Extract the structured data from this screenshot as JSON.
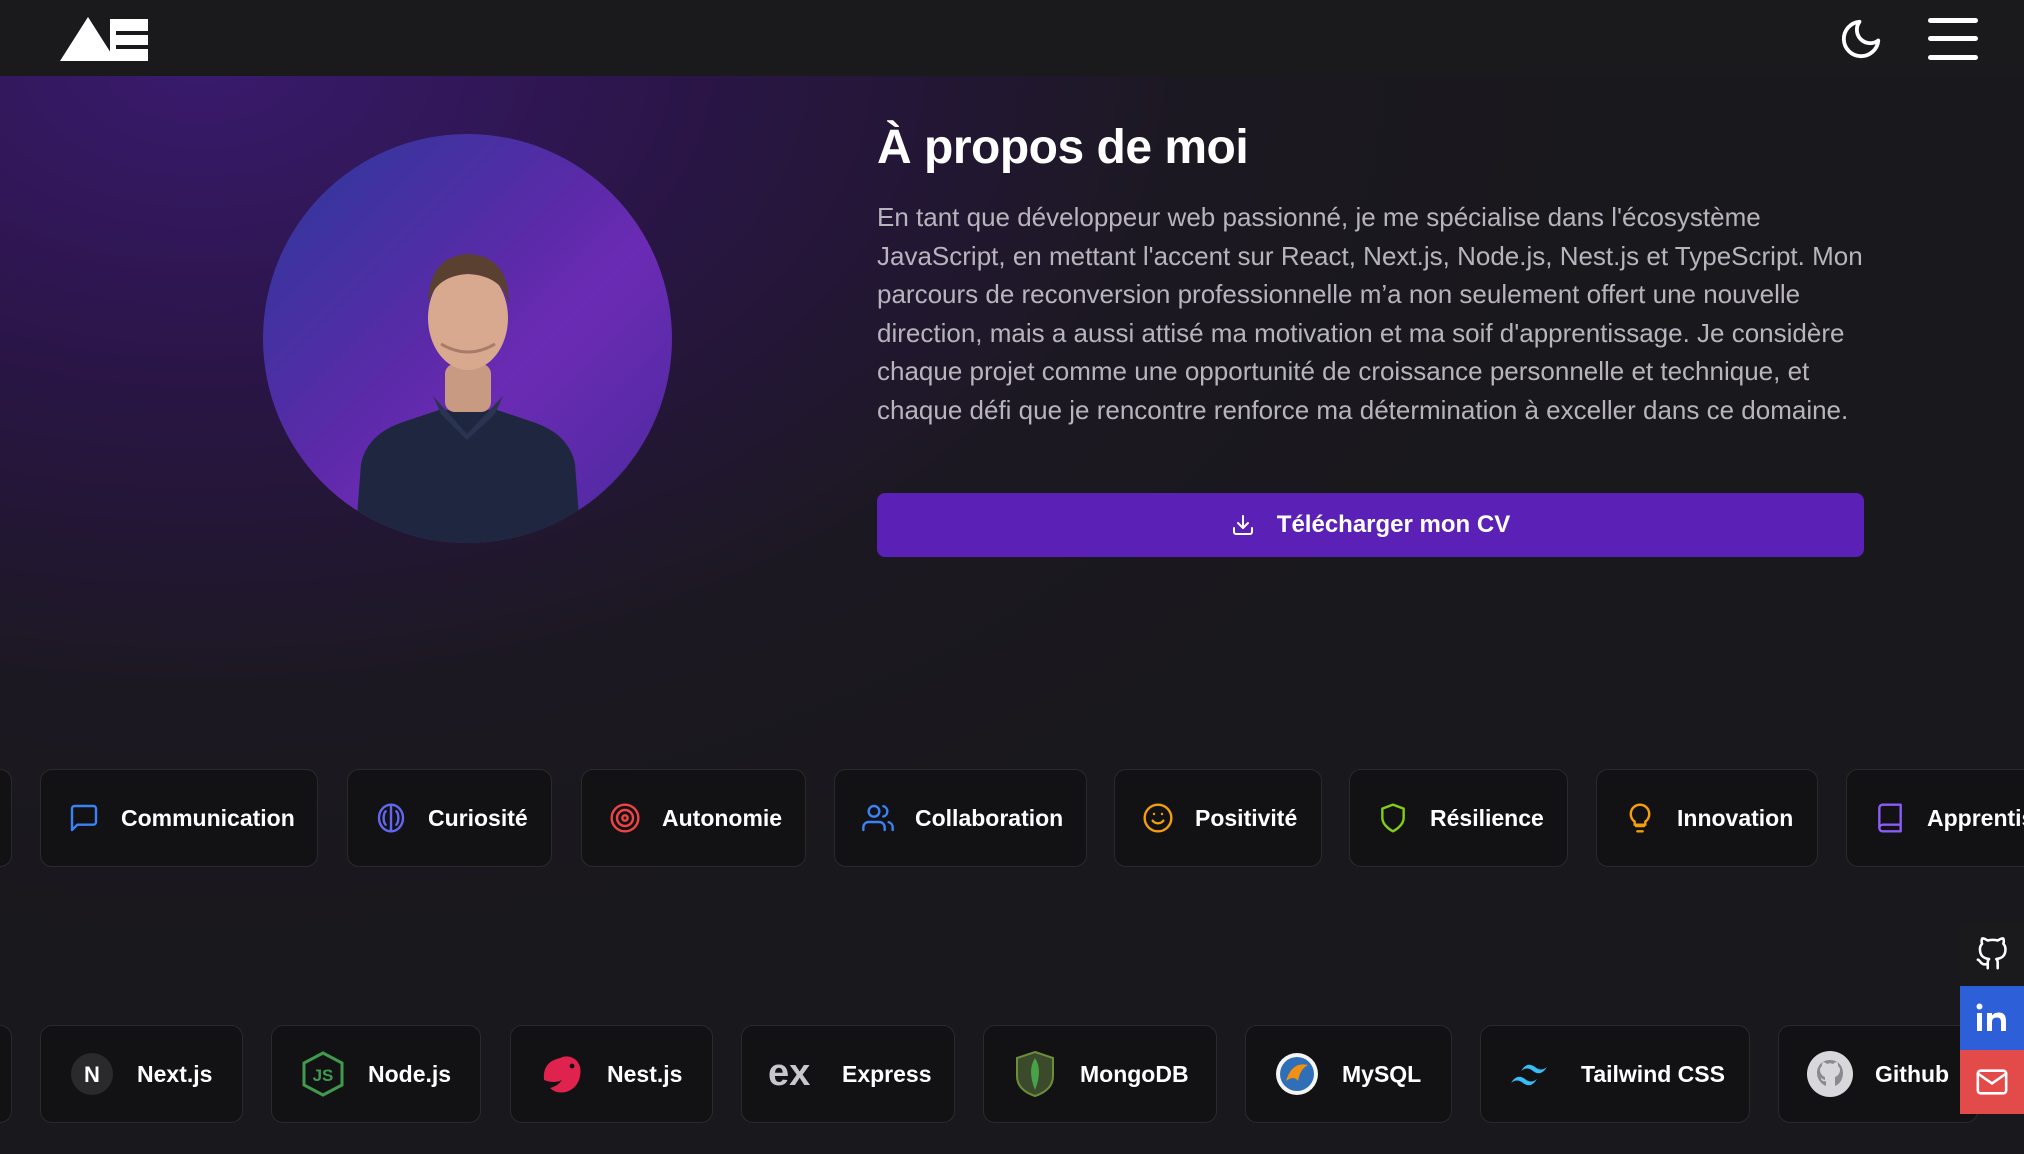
{
  "header": {
    "logo_icon": "ae-logo-icon",
    "theme_toggle_icon": "moon-icon",
    "menu_icon": "hamburger-menu-icon"
  },
  "about": {
    "title": "À propos de moi",
    "paragraph": "En tant que développeur web passionné, je me spécialise dans l'écosystème JavaScript, en mettant l'accent sur React, Next.js, Node.js, Nest.js et TypeScript. Mon parcours de reconversion professionnelle m’a non seulement offert une nouvelle direction, mais a aussi attisé ma motivation et ma soif d'apprentissage. Je considère chaque projet comme une opportunité de croissance personnelle et technique, et chaque défi que je rencontre renforce ma détermination à exceller dans ce domaine.",
    "download_button": "Télécharger mon CV",
    "download_icon": "download-icon"
  },
  "soft_skills": [
    {
      "label": "Communication",
      "icon": "message-square-icon",
      "color": "#3b82f6"
    },
    {
      "label": "Curiosité",
      "icon": "brain-icon",
      "color": "#6366f1"
    },
    {
      "label": "Autonomie",
      "icon": "target-icon",
      "color": "#ef4444"
    },
    {
      "label": "Collaboration",
      "icon": "users-icon",
      "color": "#3b82f6"
    },
    {
      "label": "Positivité",
      "icon": "smile-icon",
      "color": "#f59e0b"
    },
    {
      "label": "Résilience",
      "icon": "shield-icon",
      "color": "#84cc16"
    },
    {
      "label": "Innovation",
      "icon": "lightbulb-icon",
      "color": "#f59e0b"
    },
    {
      "label": "Apprentissage",
      "icon": "book-icon",
      "color": "#8b5cf6"
    }
  ],
  "tech_stack": [
    {
      "label": "Next.js",
      "icon": "nextjs-icon"
    },
    {
      "label": "Node.js",
      "icon": "nodejs-icon"
    },
    {
      "label": "Nest.js",
      "icon": "nestjs-icon"
    },
    {
      "label": "Express",
      "icon": "express-icon"
    },
    {
      "label": "MongoDB",
      "icon": "mongodb-icon"
    },
    {
      "label": "MySQL",
      "icon": "mysql-icon"
    },
    {
      "label": "Tailwind CSS",
      "icon": "tailwind-icon"
    },
    {
      "label": "Github",
      "icon": "github-icon"
    }
  ],
  "social": [
    {
      "icon": "github-icon",
      "color": "#1a1a1c"
    },
    {
      "icon": "linkedin-icon",
      "color": "#2c5fd8"
    },
    {
      "icon": "mail-icon",
      "color": "#e34a4a"
    }
  ]
}
